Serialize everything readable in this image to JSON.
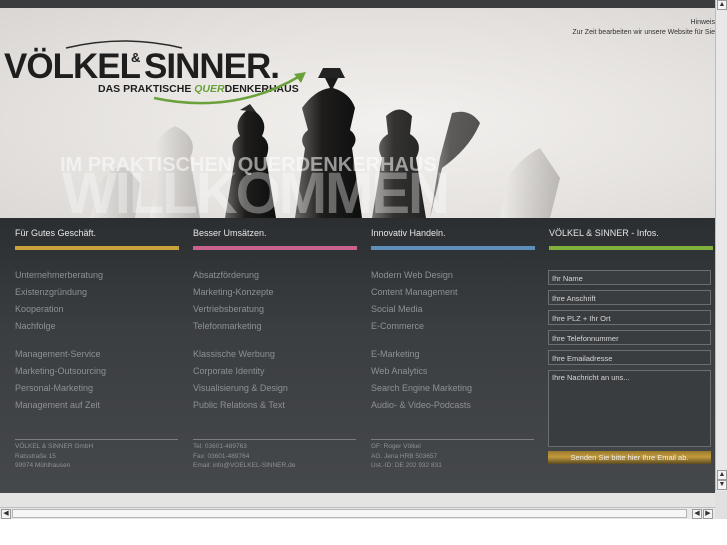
{
  "notice": {
    "title": "Hinweis",
    "text": "Zur Zeit bearbeiten wir unsere Website für Sie"
  },
  "logo": {
    "brand": "VÖLKEL & SINNER.",
    "tagline_left": "DAS PRAKTISCHE ",
    "tagline_quer": "QUER",
    "tagline_right": "DENKERHAUS"
  },
  "hero": {
    "subtitle": "IM PRAKTISCHEN QUERDENKERHAUS",
    "title": "WILLKOMMEN"
  },
  "colors": {
    "col1_bar": "#c9a23b",
    "col2_bar": "#c9628f",
    "col3_bar": "#5d8fb9",
    "col4_bar": "#7db13a",
    "logo_green": "#6aa13a"
  },
  "columns": [
    {
      "heading": "Für Gutes Geschäft.",
      "group1": [
        "Unternehmerberatung",
        "Existenzgründung",
        "Kooperation",
        "Nachfolge"
      ],
      "group2": [
        "Management-Service",
        "Marketing-Outsourcing",
        "Personal-Marketing",
        "Management auf Zeit"
      ],
      "footer": [
        "VÖLKEL & SINNER GmbH",
        "Ratsstraße 15",
        "99974 Mühlhausen"
      ]
    },
    {
      "heading": "Besser Umsätzen.",
      "group1": [
        "Absatzförderung",
        "Marketing-Konzepte",
        "Vertriebsberatung",
        "Telefonmarketing"
      ],
      "group2": [
        "Klassische Werbung",
        "Corporate Identity",
        "Visualisierung & Design",
        "Public Relations & Text"
      ],
      "footer": [
        "Tel: 03601-489763",
        "Fax: 03601-489764",
        "Email: info@VOELKEL-SINNER.de"
      ]
    },
    {
      "heading": "Innovativ Handeln.",
      "group1": [
        "Modern Web Design",
        "Content Management",
        "Social Media",
        "E-Commerce"
      ],
      "group2": [
        "E-Marketing",
        "Web Analytics",
        "Search Engine Marketing",
        "Audio- & Video-Podcasts"
      ],
      "footer": [
        "GF: Roger Völkel",
        "AG. Jena HRB 503657",
        "Ust.-ID: DE 202 932 831"
      ]
    }
  ],
  "form": {
    "heading": "VÖLKEL & SINNER - Infos.",
    "name": "Ihr Name",
    "address": "Ihre Anschrift",
    "city": "Ihre PLZ + Ihr Ort",
    "phone": "Ihre Telefonnummer",
    "email": "Ihre Emailadresse",
    "message": "Ihre Nachricht an uns...",
    "submit": "Senden Sie bitte hier Ihre Email ab."
  },
  "scrollbar": {
    "up": "▲",
    "down": "▼",
    "left": "◀",
    "right": "▶"
  }
}
